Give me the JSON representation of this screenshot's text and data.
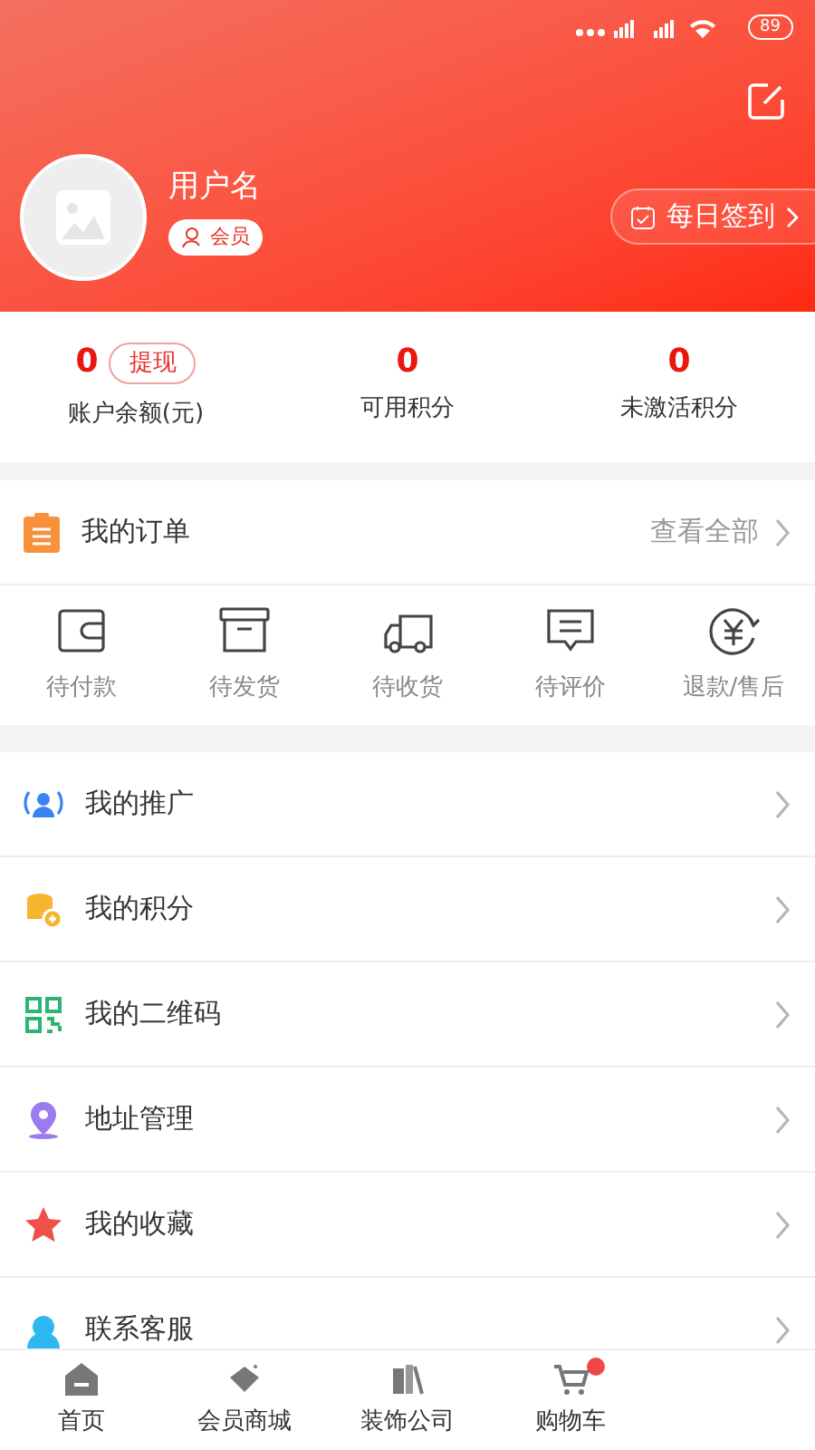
{
  "status_bar": {
    "battery": "89"
  },
  "profile": {
    "username": "用户名",
    "badge": "会员",
    "checkin_button": "每日签到"
  },
  "stats": [
    {
      "value": "0",
      "label": "账户余额(元)",
      "action": "提现"
    },
    {
      "value": "0",
      "label": "可用积分"
    },
    {
      "value": "0",
      "label": "未激活积分"
    }
  ],
  "orders": {
    "title": "我的订单",
    "view_all": "查看全部",
    "items": [
      {
        "kind": "wallet",
        "label": "待付款"
      },
      {
        "kind": "box",
        "label": "待发货"
      },
      {
        "kind": "truck",
        "label": "待收货"
      },
      {
        "kind": "comment",
        "label": "待评价"
      },
      {
        "kind": "refund",
        "label": "退款/售后"
      }
    ]
  },
  "menu": [
    {
      "kind": "promote",
      "label": "我的推广",
      "color": "#3b82f6"
    },
    {
      "kind": "points",
      "label": "我的积分",
      "color": "#f5b52e"
    },
    {
      "kind": "qrcode",
      "label": "我的二维码",
      "color": "#2bb673"
    },
    {
      "kind": "address",
      "label": "地址管理",
      "color": "#9b7bf0"
    },
    {
      "kind": "favorite",
      "label": "我的收藏",
      "color": "#f0504a"
    },
    {
      "kind": "service",
      "label": "联系客服",
      "color": "#2fb8f0"
    }
  ],
  "tab_bar": [
    {
      "kind": "home",
      "label": "首页",
      "selected": false,
      "badge": false
    },
    {
      "kind": "tag",
      "label": "会员商城",
      "selected": false,
      "badge": false
    },
    {
      "kind": "company",
      "label": "装饰公司",
      "selected": false,
      "badge": false
    },
    {
      "kind": "cart",
      "label": "购物车",
      "selected": false,
      "badge": true
    }
  ]
}
